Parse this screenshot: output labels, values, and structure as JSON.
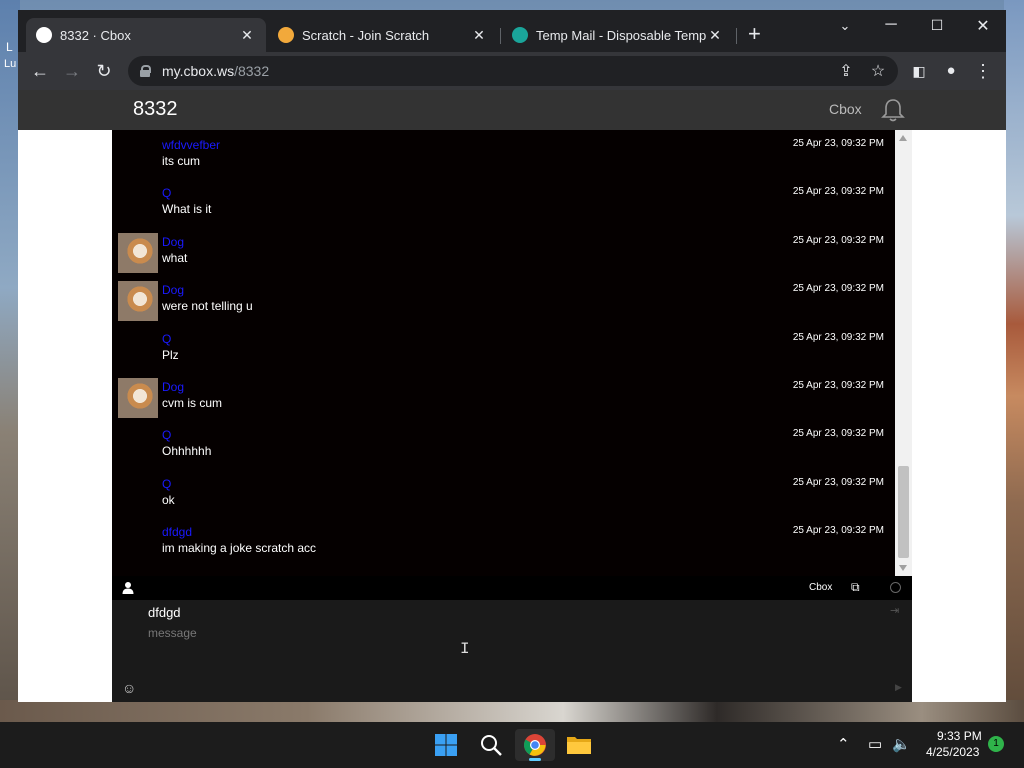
{
  "desktop": {
    "left_glyph_1": "L",
    "left_glyph_2": "Lu"
  },
  "browser": {
    "tabs": [
      {
        "title": "8332 · Cbox",
        "favicon_color": "#ffffff",
        "active": true
      },
      {
        "title": "Scratch - Join Scratch",
        "favicon_color": "#f2a93b",
        "active": false
      },
      {
        "title": "Temp Mail - Disposable Tempora",
        "favicon_color": "#1aa59a",
        "active": false
      }
    ],
    "new_tab_label": "+",
    "url_host": "my.cbox.ws",
    "url_path": "/8332"
  },
  "site": {
    "title": "8332",
    "brand": "Cbox"
  },
  "messages": [
    {
      "user": "wfdvvefber",
      "text": "its cum",
      "time": "25 Apr 23, 09:32 PM",
      "avatar": false
    },
    {
      "user": "Q",
      "text": "What is it",
      "time": "25 Apr 23, 09:32 PM",
      "avatar": false
    },
    {
      "user": "Dog",
      "text": "what",
      "time": "25 Apr 23, 09:32 PM",
      "avatar": true
    },
    {
      "user": "Dog",
      "text": "were not telling u",
      "time": "25 Apr 23, 09:32 PM",
      "avatar": true
    },
    {
      "user": "Q",
      "text": "Plz",
      "time": "25 Apr 23, 09:32 PM",
      "avatar": false
    },
    {
      "user": "Dog",
      "text": "cvm is cum",
      "time": "25 Apr 23, 09:32 PM",
      "avatar": true
    },
    {
      "user": "Q",
      "text": "Ohhhhhh",
      "time": "25 Apr 23, 09:32 PM",
      "avatar": false
    },
    {
      "user": "Q",
      "text": "ok",
      "time": "25 Apr 23, 09:32 PM",
      "avatar": false
    },
    {
      "user": "dfdgd",
      "text": "im making a joke scratch acc",
      "time": "25 Apr 23, 09:32 PM",
      "avatar": false
    }
  ],
  "cbox_bar": {
    "brand": "Cbox"
  },
  "compose": {
    "name_value": "dfdgd",
    "message_placeholder": "message"
  },
  "taskbar": {
    "time": "9:33 PM",
    "date": "4/25/2023",
    "notification_count": "1"
  },
  "colors": {
    "username": "#1a1aff",
    "chat_bg": "#050000",
    "header_bg": "#333333",
    "chrome_bg": "#202124",
    "toolbar_bg": "#35363a"
  }
}
